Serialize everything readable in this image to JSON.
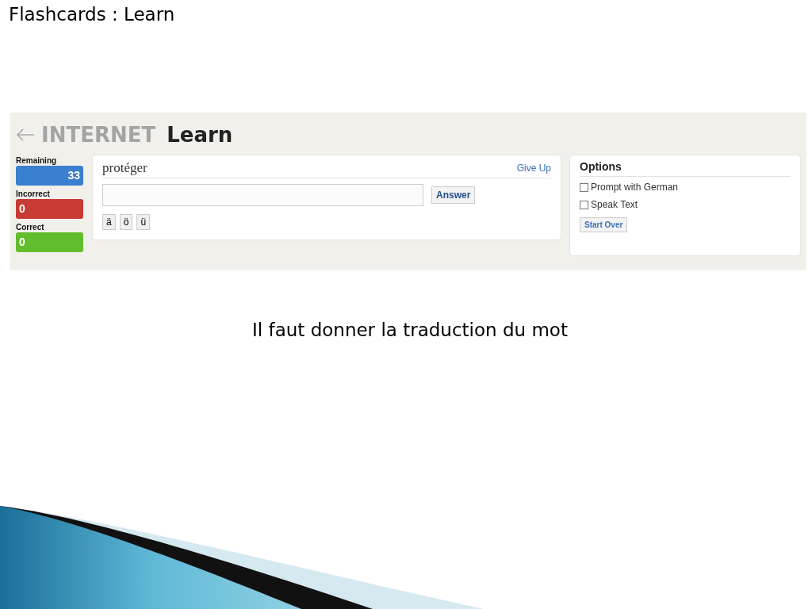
{
  "slide_title": "Flashcards : Learn",
  "app": {
    "set_name": "INTERNET",
    "mode": "Learn",
    "scores": [
      {
        "label": "Remaining",
        "value": "33",
        "color": "#3a7fd0"
      },
      {
        "label": "Incorrect",
        "value": "0",
        "color": "#c83a34"
      },
      {
        "label": "Correct",
        "value": "0",
        "color": "#62bd2c"
      }
    ],
    "card": {
      "prompt": "protéger",
      "give_up": "Give Up",
      "answer_button": "Answer",
      "accent_keys": [
        "ä",
        "ö",
        "ü"
      ]
    },
    "options": {
      "title": "Options",
      "checkboxes": [
        {
          "label": "Prompt with German",
          "checked": false
        },
        {
          "label": "Speak Text",
          "checked": false
        }
      ],
      "start_over": "Start Over"
    }
  },
  "caption": "Il faut donner la traduction du mot"
}
